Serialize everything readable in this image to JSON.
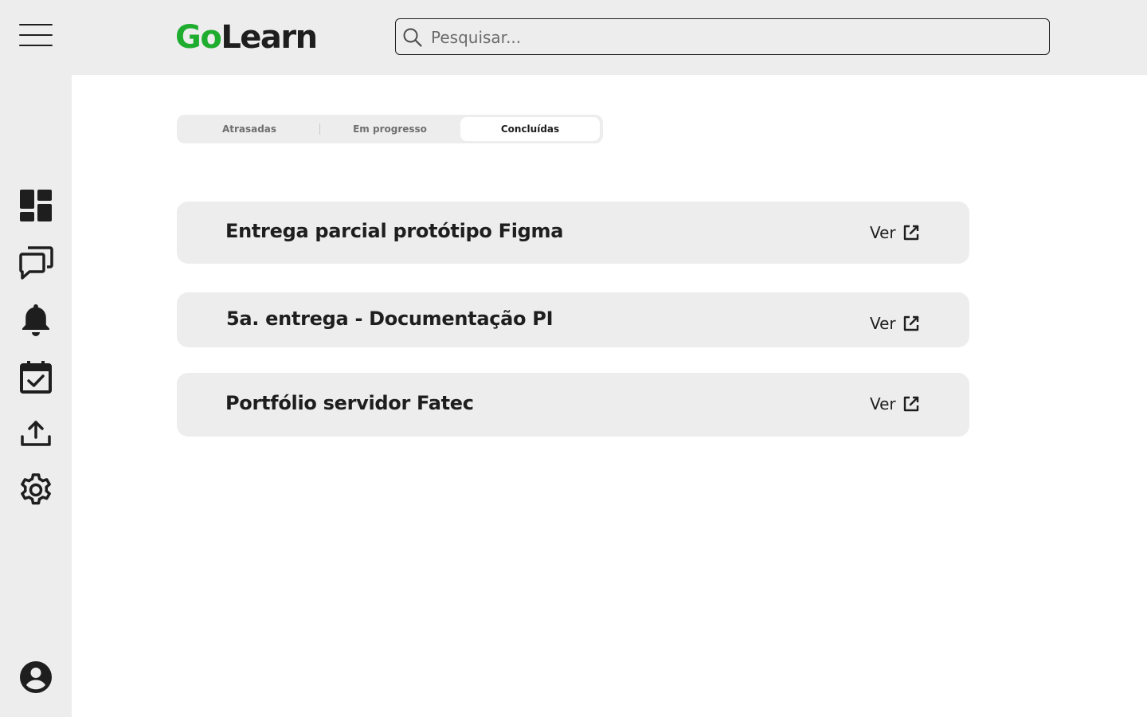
{
  "header": {
    "logo_go": "Go",
    "logo_learn": "Learn",
    "search": {
      "placeholder": "Pesquisar..."
    }
  },
  "colors": {
    "brand_green": "#1fad2f",
    "text": "#1e1e1e",
    "bg_gray": "#ededed"
  },
  "sidebar": {
    "icons": [
      "dashboard-icon",
      "chat-icon",
      "bell-icon",
      "calendar-check-icon",
      "upload-icon",
      "gear-icon"
    ],
    "profile_icon": "account-icon"
  },
  "tabs": [
    {
      "label": "Atrasadas",
      "active": false
    },
    {
      "label": "Em progresso",
      "active": false
    },
    {
      "label": "Concluídas",
      "active": true
    }
  ],
  "tasks": [
    {
      "title": "Entrega parcial protótipo Figma",
      "action": "Ver"
    },
    {
      "title": "5a. entrega - Documentação PI",
      "action": "Ver"
    },
    {
      "title": "Portfólio servidor Fatec",
      "action": "Ver"
    }
  ]
}
